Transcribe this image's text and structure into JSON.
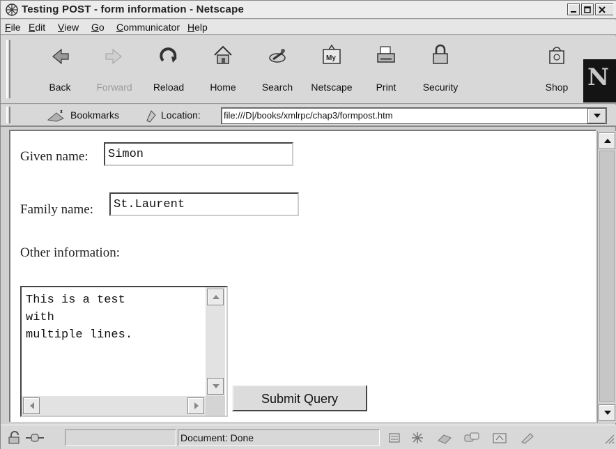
{
  "window": {
    "title": "Testing POST - form information - Netscape"
  },
  "menubar": {
    "items": [
      {
        "accel": "F",
        "rest": "ile"
      },
      {
        "accel": "",
        "rest": "Edit",
        "accel_after": "E"
      },
      {
        "accel": "V",
        "rest": "iew"
      },
      {
        "accel": "G",
        "rest": "o"
      },
      {
        "accel": "C",
        "rest": "ommunicator"
      },
      {
        "accel": "H",
        "rest": "elp"
      }
    ]
  },
  "toolbar": {
    "buttons": [
      {
        "label": "Back",
        "icon": "back-arrow-icon",
        "enabled": true
      },
      {
        "label": "Forward",
        "icon": "forward-arrow-icon",
        "enabled": false
      },
      {
        "label": "Reload",
        "icon": "reload-icon",
        "enabled": true
      },
      {
        "label": "Home",
        "icon": "home-icon",
        "enabled": true
      },
      {
        "label": "Search",
        "icon": "search-icon",
        "enabled": true
      },
      {
        "label": "Netscape",
        "icon": "netscape-icon",
        "enabled": true
      },
      {
        "label": "Print",
        "icon": "print-icon",
        "enabled": true
      },
      {
        "label": "Security",
        "icon": "security-icon",
        "enabled": true
      },
      {
        "label": "Shop",
        "icon": "shop-icon",
        "enabled": true
      }
    ],
    "logo_letter": "N"
  },
  "locationbar": {
    "bookmarks_label": "Bookmarks",
    "location_label": "Location:",
    "url": "file:///D|/books/xmlrpc/chap3/formpost.htm"
  },
  "form": {
    "given_name_label": "Given name:",
    "given_name_value": "Simon",
    "family_name_label": "Family name:",
    "family_name_value": "St.Laurent",
    "other_label": "Other information:",
    "other_value": "This is a test\nwith\nmultiple lines.",
    "submit_label": "Submit Query"
  },
  "statusbar": {
    "text": "Document: Done"
  },
  "colors": {
    "chrome": "#d8d8d8",
    "content_bg": "#ffffff",
    "logo_bg": "#141414"
  }
}
